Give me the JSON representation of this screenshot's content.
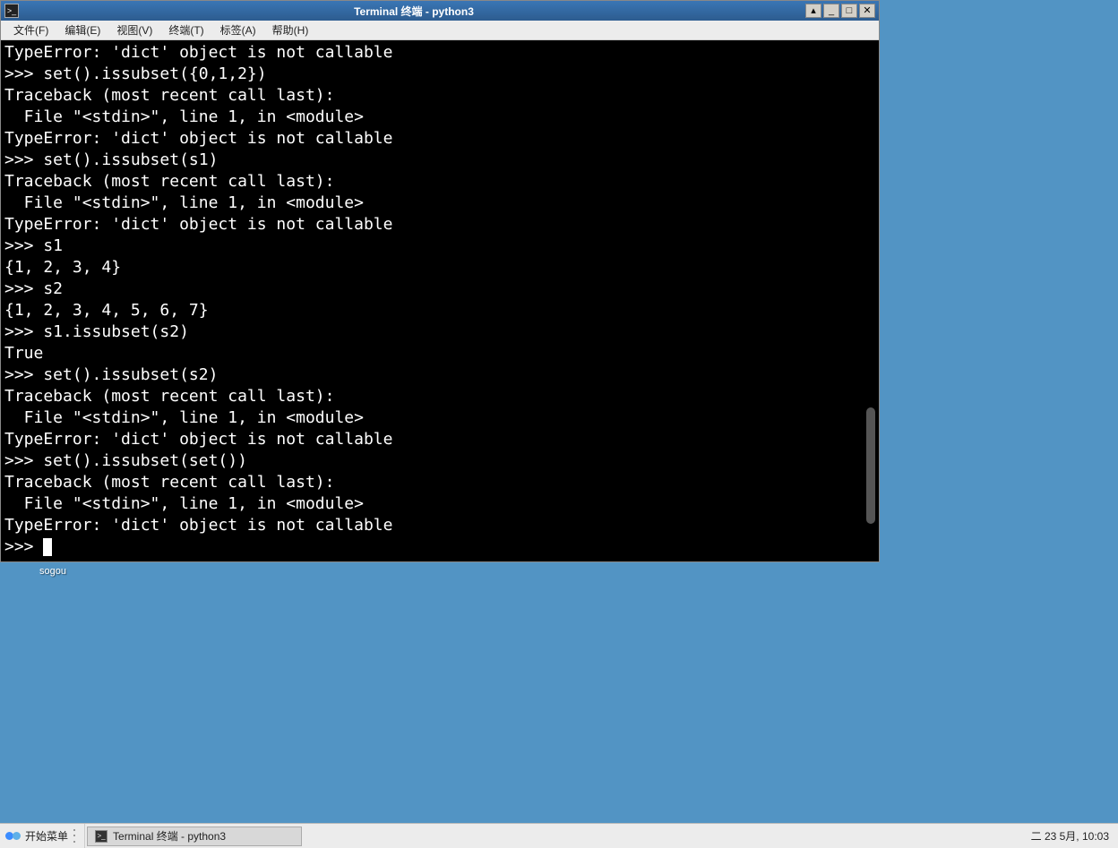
{
  "window": {
    "title": "Terminal 终端 - python3"
  },
  "menubar": {
    "file": "文件(F)",
    "edit": "编辑(E)",
    "view": "视图(V)",
    "terminal": "终端(T)",
    "tabs": "标签(A)",
    "help": "帮助(H)"
  },
  "terminal": {
    "lines": [
      "TypeError: 'dict' object is not callable",
      ">>> set().issubset({0,1,2})",
      "Traceback (most recent call last):",
      "  File \"<stdin>\", line 1, in <module>",
      "TypeError: 'dict' object is not callable",
      ">>> set().issubset(s1)",
      "Traceback (most recent call last):",
      "  File \"<stdin>\", line 1, in <module>",
      "TypeError: 'dict' object is not callable",
      ">>> s1",
      "{1, 2, 3, 4}",
      ">>> s2",
      "{1, 2, 3, 4, 5, 6, 7}",
      ">>> s1.issubset(s2)",
      "True",
      ">>> set().issubset(s2)",
      "Traceback (most recent call last):",
      "  File \"<stdin>\", line 1, in <module>",
      "TypeError: 'dict' object is not callable",
      ">>> set().issubset(set())",
      "Traceback (most recent call last):",
      "  File \"<stdin>\", line 1, in <module>",
      "TypeError: 'dict' object is not callable"
    ],
    "prompt": ">>> "
  },
  "ime": {
    "label": "sogou"
  },
  "taskbar": {
    "start": "开始菜单",
    "task_label": "Terminal 终端 - python3",
    "clock": "二 23 5月, 10:03"
  }
}
